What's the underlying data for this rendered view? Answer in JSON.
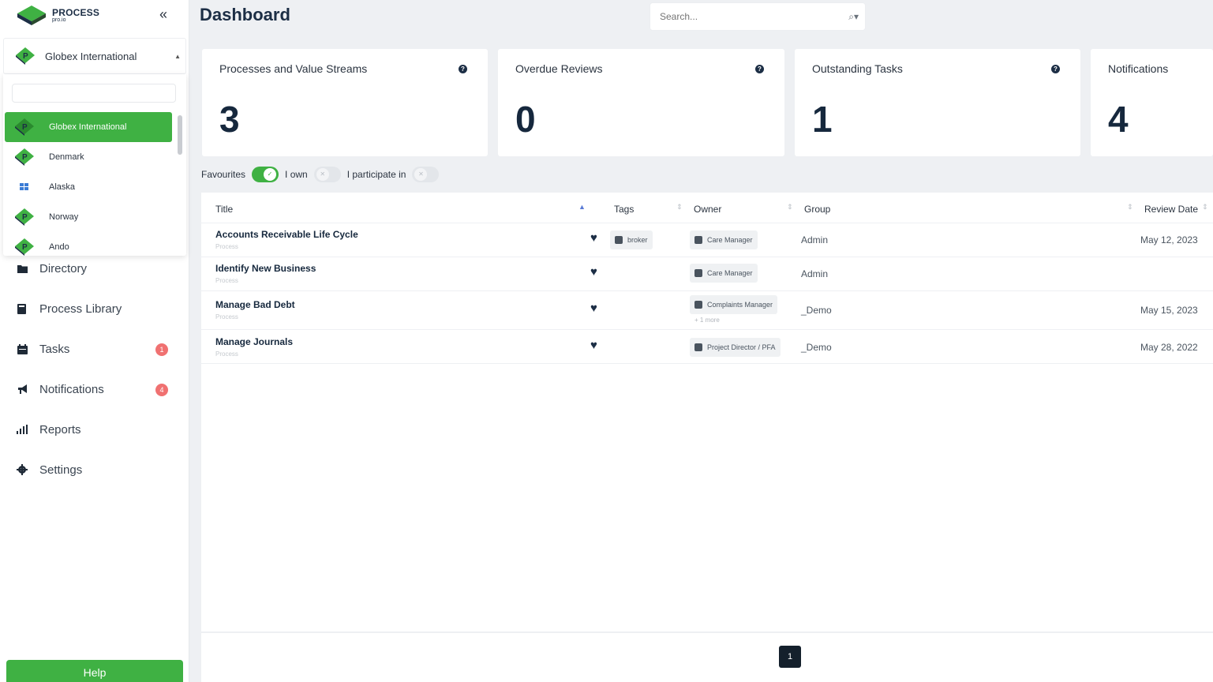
{
  "app": {
    "logo_line1": "PROCESS",
    "logo_line2": "pro.io"
  },
  "colors": {
    "accent_green": "#3fb143",
    "navy": "#1c2e45",
    "badge_red": "#f07171"
  },
  "org_selector": {
    "selected": "Globex International",
    "options": [
      "Globex International",
      "Denmark",
      "Alaska",
      "Norway",
      "Ando"
    ]
  },
  "sidebar": {
    "items": [
      {
        "label": "Directory",
        "icon": "folder-icon"
      },
      {
        "label": "Process Library",
        "icon": "book-icon"
      },
      {
        "label": "Tasks",
        "icon": "calendar-icon",
        "badge": "1"
      },
      {
        "label": "Notifications",
        "icon": "megaphone-icon",
        "badge": "4"
      },
      {
        "label": "Reports",
        "icon": "bar-chart-icon"
      },
      {
        "label": "Settings",
        "icon": "gear-icon"
      }
    ],
    "help_label": "Help"
  },
  "header": {
    "title": "Dashboard",
    "search_placeholder": "Search..."
  },
  "cards": [
    {
      "label": "Processes and Value Streams",
      "value": "3"
    },
    {
      "label": "Overdue Reviews",
      "value": "0"
    },
    {
      "label": "Outstanding Tasks",
      "value": "1"
    },
    {
      "label": "Notifications",
      "value": "4"
    }
  ],
  "filters": {
    "favourites": {
      "label": "Favourites",
      "on": true
    },
    "i_own": {
      "label": "I own",
      "on": false
    },
    "i_participate": {
      "label": "I participate in",
      "on": false
    }
  },
  "table": {
    "columns": [
      "Title",
      "Tags",
      "Owner",
      "Group",
      "Review Date"
    ],
    "rows": [
      {
        "title": "Accounts Receivable Life Cycle",
        "type": "Process",
        "tag": "broker",
        "owner": "Care Manager",
        "owner_more": "",
        "group": "Admin",
        "review_date": "May 12, 2023"
      },
      {
        "title": "Identify New Business",
        "type": "Process",
        "tag": "",
        "owner": "Care Manager",
        "owner_more": "",
        "group": "Admin",
        "review_date": ""
      },
      {
        "title": "Manage Bad Debt",
        "type": "Process",
        "tag": "",
        "owner": "Complaints Manager",
        "owner_more": "+ 1 more",
        "group": "_Demo",
        "review_date": "May 15, 2023"
      },
      {
        "title": "Manage Journals",
        "type": "Process",
        "tag": "",
        "owner": "Project Director / PFA",
        "owner_more": "",
        "group": "_Demo",
        "review_date": "May 28, 2022"
      }
    ]
  },
  "pagination": {
    "current_page": "1"
  }
}
